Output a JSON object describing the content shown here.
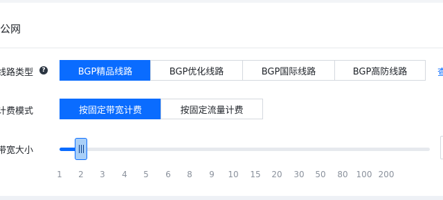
{
  "section": {
    "title": "公网"
  },
  "line_type": {
    "label": "线路类型",
    "help_icon": "?",
    "options": [
      "BGP精品线路",
      "BGP优化线路",
      "BGP国际线路",
      "BGP高防线路"
    ],
    "selected": "BGP精品线路",
    "more_link": "查"
  },
  "billing": {
    "label": "计费模式",
    "options": [
      "按固定带宽计费",
      "按固定流量计费"
    ],
    "selected": "按固定带宽计费"
  },
  "bandwidth": {
    "label": "带宽大小",
    "value": 2,
    "ticks": [
      "1",
      "2",
      "3",
      "4",
      "5",
      "6",
      "8",
      "9",
      "10",
      "15",
      "20",
      "30",
      "50",
      "80",
      "100",
      "200"
    ]
  },
  "colors": {
    "accent": "#0a6cff",
    "handle": "#a9cff7"
  }
}
